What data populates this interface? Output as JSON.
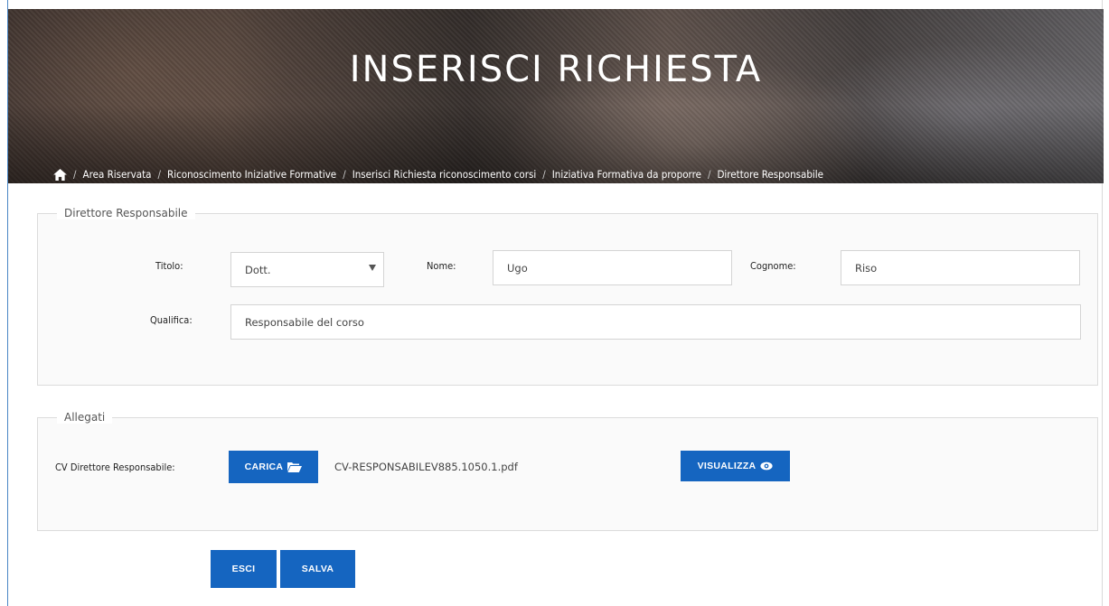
{
  "header": {
    "title": "INSERISCI RICHIESTA",
    "breadcrumb": [
      "Area Riservata",
      "Riconoscimento Iniziative Formative",
      "Inserisci Richiesta riconoscimento corsi",
      "Iniziativa Formativa da proporre",
      "Direttore Responsabile"
    ]
  },
  "director": {
    "legend": "Direttore Responsabile",
    "titolo_label": "Titolo:",
    "titolo_value": "Dott.",
    "nome_label": "Nome:",
    "nome_value": "Ugo",
    "cognome_label": "Cognome:",
    "cognome_value": "Riso",
    "qualifica_label": "Qualifica:",
    "qualifica_value": "Responsabile del corso"
  },
  "attachments": {
    "legend": "Allegati",
    "cv_label": "CV Direttore Responsabile:",
    "upload_label": "CARICA",
    "file_name": "CV-RESPONSABILEV885.1050.1.pdf",
    "view_label": "VISUALIZZA"
  },
  "actions": {
    "exit_label": "ESCI",
    "save_label": "SALVA"
  },
  "colors": {
    "primary": "#1565c0"
  },
  "icons": {
    "home": "home-icon",
    "upload": "folder-open-icon",
    "view": "eye-icon"
  }
}
